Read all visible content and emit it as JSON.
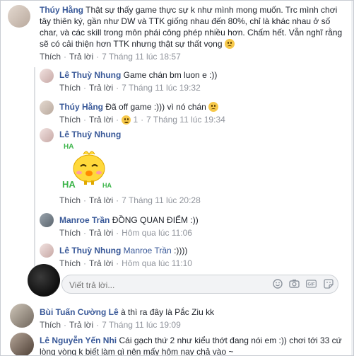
{
  "comments": [
    {
      "name": "Thúy Hằng",
      "text": "Thật sự thấy game thực sự k như mình mong muốn. Trc mình chơi tây thiên ký, gần như DW và TTK giống nhau đến 80%, chỉ là khác nhau ở số char, và các skill trong môn phái công phép nhiều hơn. Chấm hết. Vẫn nghĩ rằng sẽ có cải thiện hơn TTK nhưng thật sự thất vọng",
      "like": "Thích",
      "reply": "Trả lời",
      "time": "7 Tháng 11 lúc 18:57"
    }
  ],
  "replies": [
    {
      "name": "Lê Thuỳ Nhung",
      "text": "Game chán bm luon e :))",
      "like": "Thích",
      "reply": "Trả lời",
      "time": "7 Tháng 11 lúc 19:32"
    },
    {
      "name": "Thúy Hằng",
      "text": "Đã off game :))) vì nó chán",
      "like": "Thích",
      "reply": "Trả lời",
      "reaction_count": "1",
      "time": "7 Tháng 11 lúc 19:34"
    },
    {
      "name": "Lê Thuỳ Nhung",
      "sticker_text_1": "HA",
      "sticker_text_2": "HA",
      "sticker_text_3": "HA",
      "like": "Thích",
      "reply": "Trả lời",
      "time": "7 Tháng 11 lúc 20:28"
    },
    {
      "name": "Manroe Trần",
      "text": "ĐỒNG QUAN ĐIỂM :))",
      "like": "Thích",
      "reply": "Trả lời",
      "time": "Hôm qua lúc 11:06"
    },
    {
      "name": "Lê Thuỳ Nhung",
      "tag": "Manroe Trần",
      "text": ":))))",
      "like": "Thích",
      "reply": "Trả lời",
      "time": "Hôm qua lúc 11:10"
    }
  ],
  "reply_box": {
    "placeholder": "Viết trả lời..."
  },
  "bottom_comments": [
    {
      "name": "Bùi Tuấn Cường",
      "tag": "Lê",
      "text": "à thì ra đây là Pắc Ziu kk",
      "like": "Thích",
      "reply": "Trả lời",
      "time": "7 Tháng 11 lúc 19:09"
    },
    {
      "name": "Lê Nguyễn Yến Nhi",
      "text": "Cái gạch thứ 2 như kiểu thớt đang nói em :)) chơi tới 33 cứ lòng vòng k biết làm gì nên mấy hôm nay chả vào ~"
    }
  ],
  "colors": {
    "link": "#385898",
    "meta": "#90949c",
    "border": "#dddfe2"
  }
}
